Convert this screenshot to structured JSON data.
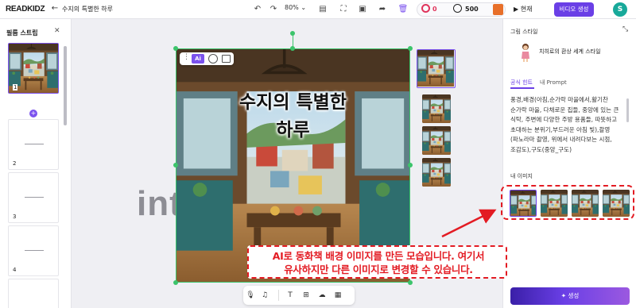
{
  "app": {
    "logo": "READKIDZ",
    "title": "수지의 특별한 하루",
    "zoom": "80%",
    "credits": {
      "left": "0",
      "right": "500"
    },
    "play_label": "현재",
    "video_button": "비디오 생성",
    "avatar_letter": "S"
  },
  "filmstrip": {
    "title": "필름 스트립",
    "pages": [
      "1",
      "2",
      "3",
      "4"
    ]
  },
  "canvas": {
    "title_line1": "수지의 특별한",
    "title_line2": "하루",
    "ai_badge": "Ai"
  },
  "watermark": "intr",
  "panel": {
    "title": "그림 스타일",
    "style_name": "치히로의 환상 세계 스타일",
    "tabs": [
      "공식 힌트",
      "내 Prompt"
    ],
    "prompt": "풍경,배경(아침,순가락 마을에서,활기찬 순가락 마을, 다채로운 집들, 중앙에 있는 큰 식탁, 주변에 다양한 주방 용품들, 따뜻하고 초대하는 분위기,부드러운 아침 빛),촬영(파노라마 촬영, 위에서 내려다보는 시점, 조감도),구도(중앙_구도)",
    "my_images_label": "내 이미지",
    "generate_button": "생성"
  },
  "annotation": {
    "line1": "AI로 동화책 배경 이미지를 만든 모습입니다. 여기서",
    "line2": "유사하지만 다른 이미지로 변경할 수 있습니다."
  },
  "colors": {
    "accent": "#6a3fe6",
    "selection": "#3cc46b",
    "annotation": "#e31b23"
  }
}
